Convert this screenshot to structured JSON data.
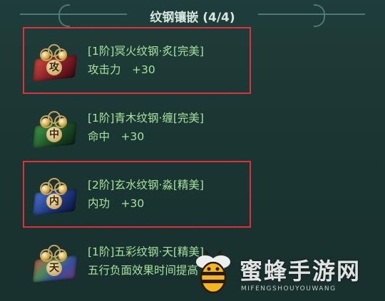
{
  "panel": {
    "title": "纹钢镶嵌 (4/4)"
  },
  "items": [
    {
      "char": "攻",
      "name": "[1阶]冥火纹钢·炙[完美]",
      "stat": "攻击力　+30",
      "color": "#b02a2a",
      "highlighted": true
    },
    {
      "char": "中",
      "name": "[1阶]青木纹钢·缠[完美]",
      "stat": "命中　+30",
      "color": "#2f7a3a",
      "highlighted": false
    },
    {
      "char": "内",
      "name": "[2阶]玄水纹钢·淼[精美]",
      "stat": "内功　+30",
      "color": "#2c4fa8",
      "highlighted": true
    },
    {
      "char": "天",
      "name": "[1阶]五彩纹钢·天[精美]",
      "stat": "五行负面效果时间提高 +20",
      "color": "#6a5a9a",
      "highlighted": false
    }
  ],
  "watermark": {
    "text": "蜜蜂手游网",
    "sub": "MIFENGSHOUYOUWANG"
  },
  "colors": {
    "text_green": "#a7e39b",
    "highlight_red": "#e0303a",
    "background": "#1a3533"
  }
}
